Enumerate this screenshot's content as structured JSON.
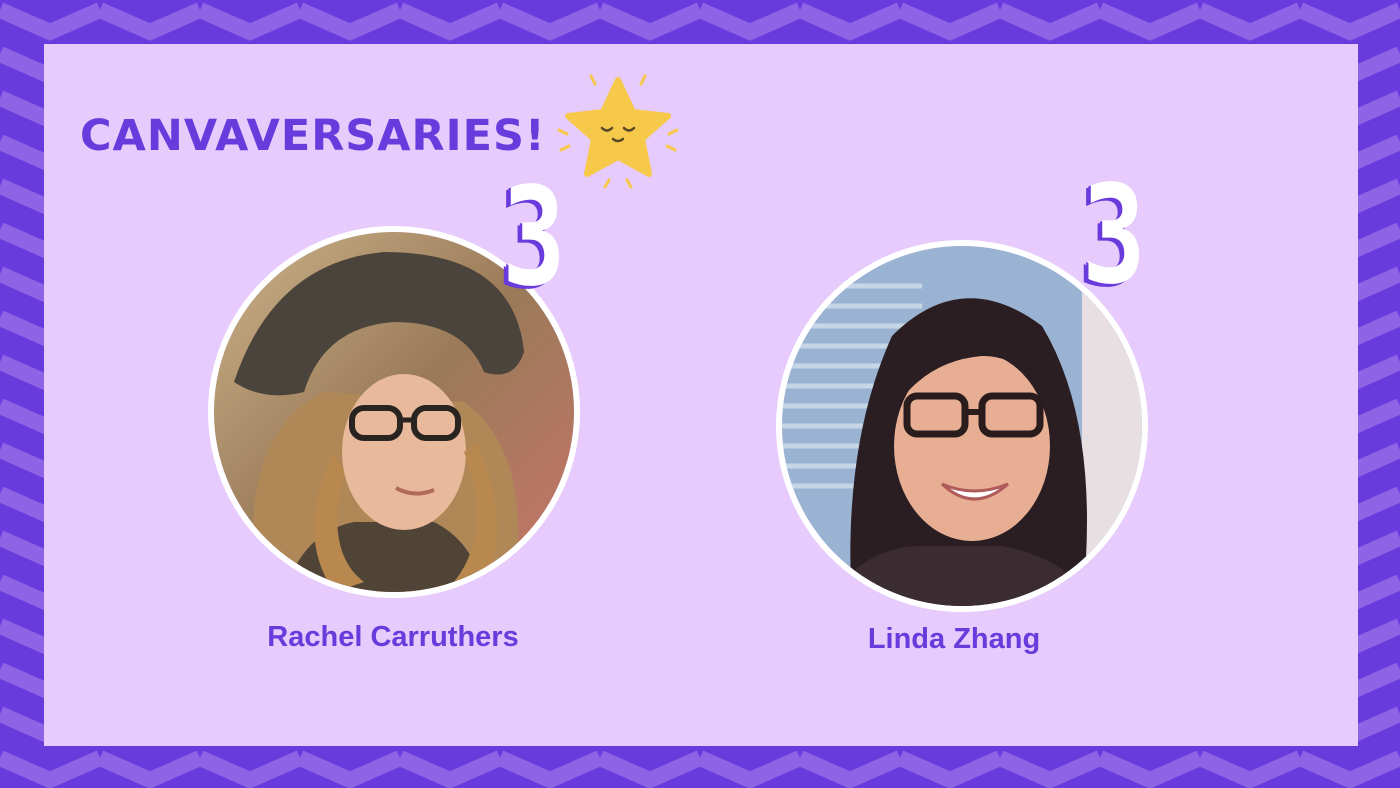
{
  "title": "CANVAVERSARIES!",
  "colors": {
    "border_dark": "#6a3bdc",
    "border_light": "#8e63e6",
    "panel": "#e6cbfc",
    "text": "#6a3bdc",
    "star": "#f7c94a"
  },
  "decoration": {
    "star_icon": "sleeping-star-icon"
  },
  "people": [
    {
      "name": "Rachel Carruthers",
      "years": "3",
      "photo": "portrait-photo"
    },
    {
      "name": "Linda Zhang",
      "years": "3",
      "photo": "portrait-photo"
    }
  ]
}
